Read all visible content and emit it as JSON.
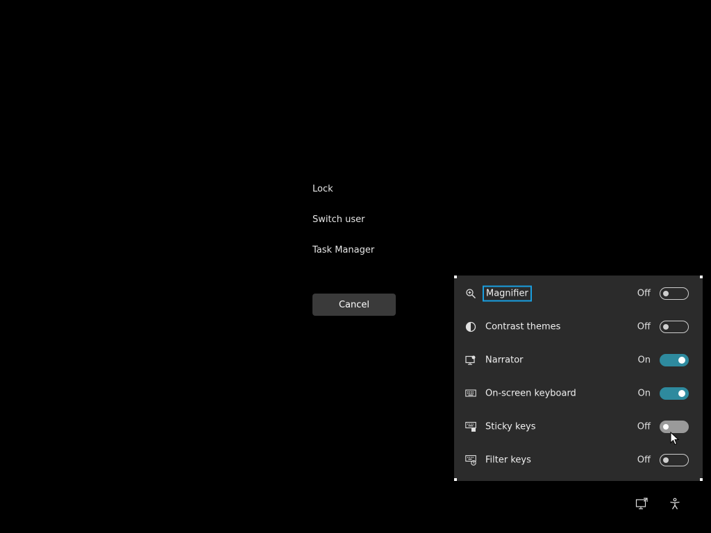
{
  "menu": {
    "lock": "Lock",
    "switch_user": "Switch user",
    "task_manager": "Task Manager"
  },
  "cancel_label": "Cancel",
  "accessibility": {
    "items": [
      {
        "label": "Magnifier",
        "state": "Off",
        "on": false,
        "icon": "magnifier-icon"
      },
      {
        "label": "Contrast themes",
        "state": "Off",
        "on": false,
        "icon": "contrast-icon"
      },
      {
        "label": "Narrator",
        "state": "On",
        "on": true,
        "icon": "narrator-icon"
      },
      {
        "label": "On-screen keyboard",
        "state": "On",
        "on": true,
        "icon": "keyboard-icon"
      },
      {
        "label": "Sticky keys",
        "state": "Off",
        "on": false,
        "icon": "sticky-keys-icon"
      },
      {
        "label": "Filter keys",
        "state": "Off",
        "on": false,
        "icon": "filter-keys-icon"
      }
    ]
  },
  "colors": {
    "toggle_on": "#2e8a9e",
    "focus_outline": "#1a9fe0",
    "panel_bg": "#2b2b2b"
  },
  "tray": {
    "icons": [
      "network-icon",
      "accessibility-icon"
    ]
  }
}
